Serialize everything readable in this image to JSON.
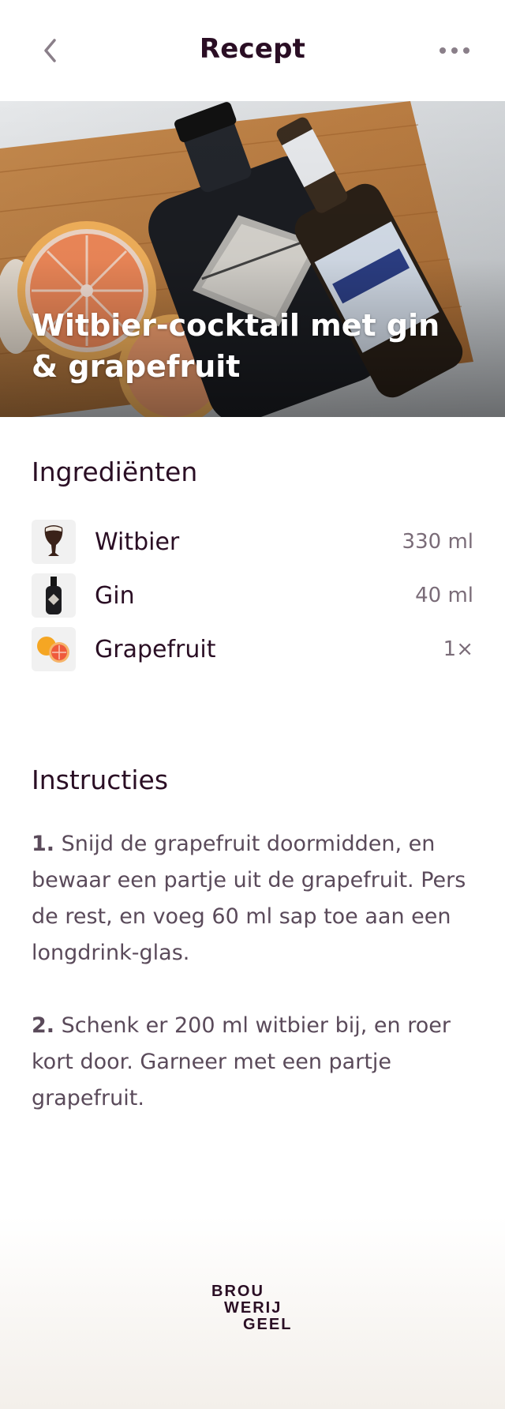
{
  "header": {
    "title": "Recept",
    "back_icon": "chevron-left-icon",
    "more_icon": "more-horizontal-icon"
  },
  "hero": {
    "title": "Witbier-cocktail met gin & grapefruit"
  },
  "ingredients": {
    "title": "Ingrediënten",
    "items": [
      {
        "name": "Witbier",
        "amount": "330 ml",
        "icon": "beer-glass-icon"
      },
      {
        "name": "Gin",
        "amount": "40 ml",
        "icon": "gin-bottle-icon"
      },
      {
        "name": "Grapefruit",
        "amount": "1×",
        "icon": "grapefruit-icon"
      }
    ]
  },
  "instructions": {
    "title": "Instructies",
    "steps": [
      {
        "number": "1.",
        "text": "Snijd de grapefruit doormidden, en bewaar een partje uit de grapefruit. Pers de rest, en voeg 60 ml sap toe aan een longdrink-glas."
      },
      {
        "number": "2.",
        "text": "Schenk er 200 ml witbier bij, en roer kort door. Garneer met een partje grapefruit."
      }
    ]
  },
  "footer": {
    "logo_line1": "BROU",
    "logo_line2": "WERIJ",
    "logo_line3": "GEEL"
  },
  "colors": {
    "text": "#2a0e24",
    "muted": "#7a6c78",
    "body": "#5a4a5a"
  }
}
